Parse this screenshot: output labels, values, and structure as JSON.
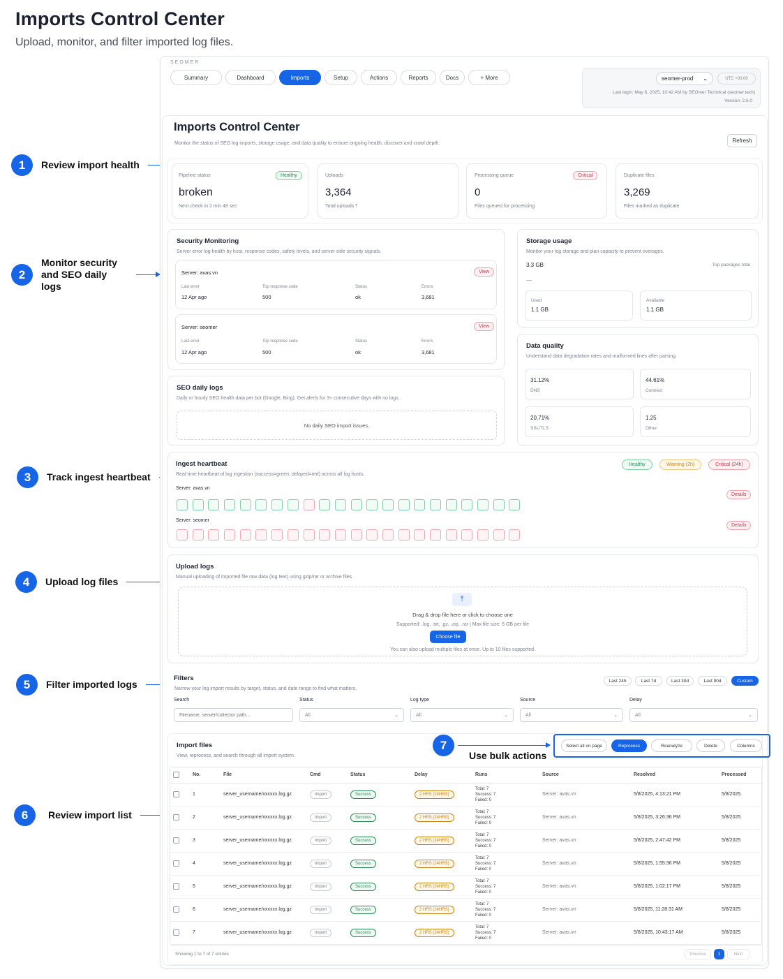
{
  "header": {
    "title": "Imports Control Center",
    "subtitle": "Upload, monitor, and filter imported log files."
  },
  "callouts": [
    {
      "num": "1",
      "text": "Review import health"
    },
    {
      "num": "2",
      "text": "Monitor security and SEO daily logs"
    },
    {
      "num": "3",
      "text": "Track ingest heartbeat"
    },
    {
      "num": "4",
      "text": "Upload log files"
    },
    {
      "num": "5",
      "text": "Filter imported logs"
    },
    {
      "num": "6",
      "text": "Review import list"
    },
    {
      "num": "7",
      "text": "Use bulk actions"
    }
  ],
  "app": {
    "brand": "SEOMER",
    "tabs": [
      "Summary",
      "Dashboard",
      "Imports",
      "Setup",
      "Actions",
      "Reports",
      "Docs",
      "+ More"
    ],
    "account": "seomer-prod",
    "timezone": "UTC +00:00",
    "last_login": "Last login: May 8, 2025, 10:42 AM by SEOmer Technical (seomer.tech)",
    "version": "Version: 2.6.0"
  },
  "page": {
    "title": "Imports Control Center",
    "desc": "Monitor the status of SEO log imports, storage usage, and data quality to ensure ongoing health, discover and crawl depth.",
    "refresh": "Refresh"
  },
  "stats": [
    {
      "label": "Pipeline status",
      "value": "broken",
      "sub": "Next check in 2 min 48 sec",
      "badge": "Healthy"
    },
    {
      "label": "Uploads",
      "value": "3,364",
      "sub": "Total uploads ⤒",
      "badge": ""
    },
    {
      "label": "Processing queue",
      "value": "0",
      "sub": "Files queued for processing",
      "badge": "Critical"
    },
    {
      "label": "Duplicate files",
      "value": "3,269",
      "sub": "Files marked as duplicate",
      "badge": ""
    }
  ],
  "security": {
    "title": "Security Monitoring",
    "desc": "Server error log health by host, response codes, safety levels, and server side security signals.",
    "col_labels": [
      "Last error",
      "Top response code",
      "Status",
      "Errors"
    ],
    "view": "View",
    "servers": [
      {
        "name": "Server: avas.vn",
        "last_error": "12 Apr ago",
        "code": "500",
        "status": "ok",
        "errors": "3,681"
      },
      {
        "name": "Server: seomer",
        "last_error": "12 Apr ago",
        "code": "500",
        "status": "ok",
        "errors": "3,681"
      }
    ]
  },
  "seo_daily": {
    "title": "SEO daily logs",
    "desc": "Daily or hourly SEO health data per bot (Google, Bing). Get alerts for 3+ consecutive days with no logs.",
    "empty": "No daily SEO import issues."
  },
  "storage": {
    "title": "Storage usage",
    "desc": "Monitor your log storage and plan capacity to prevent overages.",
    "total": "3.3 GB",
    "top_label": "Top packages total",
    "used_label": "Used",
    "used": "1.1 GB",
    "avail_label": "Available",
    "avail": "1.1 GB"
  },
  "quality": {
    "title": "Data quality",
    "desc": "Understand data degradation rates and malformed lines after parsing.",
    "metrics": [
      {
        "value": "31.12%",
        "label": "DNS"
      },
      {
        "value": "44.61%",
        "label": "Connect"
      },
      {
        "value": "20.71%",
        "label": "SSL/TLS"
      },
      {
        "value": "1.25",
        "label": "Other"
      }
    ]
  },
  "heartbeat": {
    "title": "Ingest heartbeat",
    "desc": "Real-time heartbeat of log ingestion (success=green, delayed=red) across all log hosts.",
    "legend": [
      "Healthy",
      "Warning (2h)",
      "Critical (24h)"
    ],
    "details": "Details",
    "rows": [
      {
        "name": "Server: avas.vn",
        "cells": [
          "g",
          "g",
          "g",
          "g",
          "g",
          "g",
          "g",
          "g",
          "r",
          "g",
          "g",
          "g",
          "g",
          "g",
          "g",
          "g",
          "g",
          "g",
          "g",
          "g",
          "g",
          "g"
        ]
      },
      {
        "name": "Server: seomer",
        "cells": [
          "r",
          "r",
          "r",
          "r",
          "r",
          "r",
          "r",
          "r",
          "r",
          "r",
          "r",
          "r",
          "r",
          "r",
          "r",
          "r",
          "r",
          "r",
          "r",
          "r",
          "r",
          "r"
        ]
      }
    ]
  },
  "upload": {
    "title": "Upload logs",
    "desc": "Manual uploading of imported file raw data (log text) using gzip/rar or archive files.",
    "drop": "Drag & drop file here or click to choose one",
    "supported": "Supported: .log, .txt, .gz, .zip, .rar | Max file size: 5 GB per file",
    "button": "Choose file",
    "note": "You can also upload multiple files at once. Up to 10 files supported."
  },
  "filters": {
    "title": "Filters",
    "desc": "Narrow your log import results by target, status, and date range to find what matters.",
    "ranges": [
      "Last 24h",
      "Last 7d",
      "Last 30d",
      "Last 90d",
      "Custom"
    ],
    "search_label": "Search",
    "search_placeholder": "Filename, server/collector path...",
    "selects": [
      {
        "label": "Status",
        "value": "All"
      },
      {
        "label": "Log type",
        "value": "All"
      },
      {
        "label": "Source",
        "value": "All"
      },
      {
        "label": "Delay",
        "value": "All"
      }
    ]
  },
  "imports": {
    "title": "Import files",
    "desc": "View, reprocess, and search through all import system.",
    "bulk": [
      "Select all on page",
      "Reprocess",
      "Reanalyze",
      "Delete",
      "Columns"
    ],
    "columns": [
      "No.",
      "File",
      "Cmd",
      "Status",
      "Delay",
      "Runs",
      "Source",
      "Resolved",
      "Processed"
    ],
    "rows": [
      {
        "no": "1",
        "file": "server_username/xxxxxx.log.gz",
        "cmd": "Import",
        "status": "Success",
        "delay": "2 HRS (24HRS)",
        "total": "Total: 7",
        "success": "Success: 7",
        "failed": "Failed: 0",
        "source": "Server: avas.vn",
        "resolved": "5/8/2025, 4:13:21 PM",
        "processed": "5/8/2025"
      },
      {
        "no": "2",
        "file": "server_username/xxxxxx.log.gz",
        "cmd": "Import",
        "status": "Success",
        "delay": "2 HRS (24HRS)",
        "total": "Total: 7",
        "success": "Success: 7",
        "failed": "Failed: 0",
        "source": "Server: avas.vn",
        "resolved": "5/8/2025, 3:26:36 PM",
        "processed": "5/8/2025"
      },
      {
        "no": "3",
        "file": "server_username/xxxxxx.log.gz",
        "cmd": "Import",
        "status": "Success",
        "delay": "2 HRS (24HRS)",
        "total": "Total: 7",
        "success": "Success: 7",
        "failed": "Failed: 0",
        "source": "Server: avas.vn",
        "resolved": "5/8/2025, 2:47:42 PM",
        "processed": "5/8/2025"
      },
      {
        "no": "4",
        "file": "server_username/xxxxxx.log.gz",
        "cmd": "Import",
        "status": "Success",
        "delay": "2 HRS (24HRS)",
        "total": "Total: 7",
        "success": "Success: 7",
        "failed": "Failed: 0",
        "source": "Server: avas.vn",
        "resolved": "5/8/2025, 1:55:36 PM",
        "processed": "5/8/2025"
      },
      {
        "no": "5",
        "file": "server_username/xxxxxx.log.gz",
        "cmd": "Import",
        "status": "Success",
        "delay": "2 HRS (24HRS)",
        "total": "Total: 7",
        "success": "Success: 7",
        "failed": "Failed: 0",
        "source": "Server: avas.vn",
        "resolved": "5/8/2025, 1:02:17 PM",
        "processed": "5/8/2025"
      },
      {
        "no": "6",
        "file": "server_username/xxxxxx.log.gz",
        "cmd": "Import",
        "status": "Success",
        "delay": "2 HRS (24HRS)",
        "total": "Total: 7",
        "success": "Success: 7",
        "failed": "Failed: 0",
        "source": "Server: avas.vn",
        "resolved": "5/8/2025, 11:28:31 AM",
        "processed": "5/8/2025"
      },
      {
        "no": "7",
        "file": "server_username/xxxxxx.log.gz",
        "cmd": "Import",
        "status": "Success",
        "delay": "2 HRS (24HRS)",
        "total": "Total: 7",
        "success": "Success: 7",
        "failed": "Failed: 0",
        "source": "Server: avas.vn",
        "resolved": "5/8/2025, 10:43:17 AM",
        "processed": "5/8/2025"
      }
    ],
    "showing": "Showing 1 to 7 of 7 entries",
    "prev": "Previous",
    "page": "1",
    "next": "Next"
  },
  "colors": {
    "accent": "#1565e6",
    "healthy": "#2e8b57",
    "critical": "#d6334a",
    "warning": "#c98313"
  }
}
